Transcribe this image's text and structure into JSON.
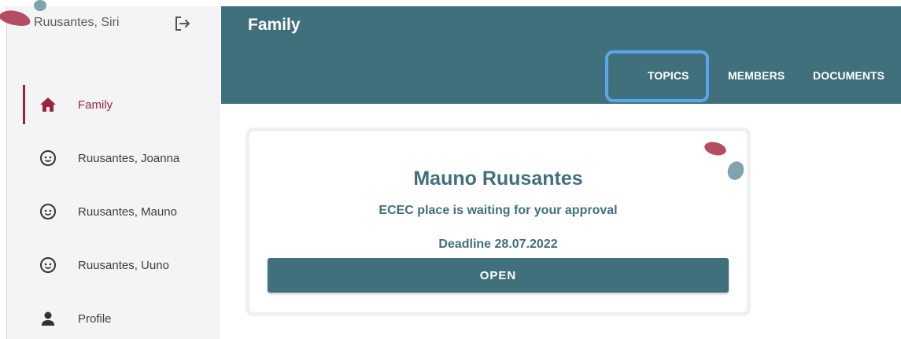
{
  "sidebar": {
    "user_name": "Ruusantes, Siri",
    "logout_icon": "logout-icon",
    "items": [
      {
        "label": "Family",
        "icon": "home-icon",
        "active": true
      },
      {
        "label": "Ruusantes, Joanna",
        "icon": "child-face-icon",
        "active": false
      },
      {
        "label": "Ruusantes, Mauno",
        "icon": "child-face-icon",
        "active": false
      },
      {
        "label": "Ruusantes, Uuno",
        "icon": "child-face-icon",
        "active": false
      },
      {
        "label": "Profile",
        "icon": "person-icon",
        "active": false
      }
    ]
  },
  "header": {
    "title": "Family",
    "tabs": [
      {
        "label": "TOPICS",
        "selected": true
      },
      {
        "label": "MEMBERS",
        "selected": false
      },
      {
        "label": "DOCUMENTS",
        "selected": false
      }
    ]
  },
  "card": {
    "child_name": "Mauno Ruusantes",
    "status": "ECEC place is waiting for your approval",
    "deadline": "Deadline 28.07.2022",
    "open_label": "OPEN"
  },
  "colors": {
    "primary": "#40707c",
    "active_nav": "#9b2340",
    "accent_red": "#b54d62",
    "accent_blue": "#7fa4ae",
    "highlight": "#5aa6e8",
    "sidebar_bg": "#f3f4f5"
  }
}
